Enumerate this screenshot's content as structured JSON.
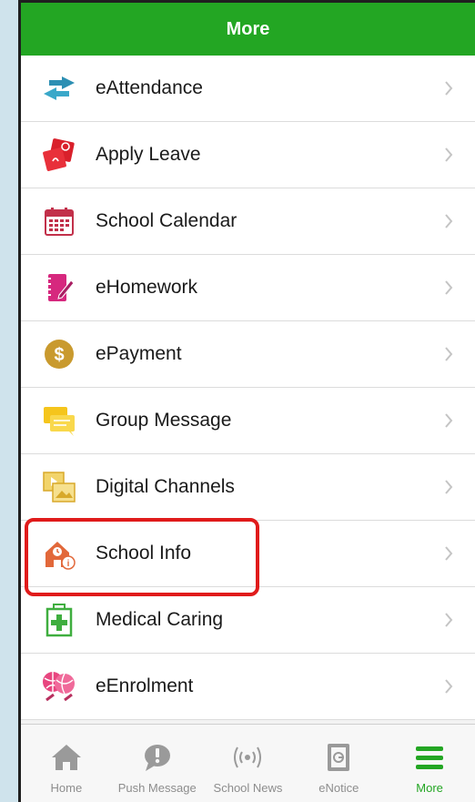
{
  "header": {
    "title": "More"
  },
  "menu": {
    "items": [
      {
        "label": "eAttendance",
        "icon": "swap-arrows-icon"
      },
      {
        "label": "Apply Leave",
        "icon": "leave-form-icon"
      },
      {
        "label": "School Calendar",
        "icon": "calendar-icon"
      },
      {
        "label": "eHomework",
        "icon": "homework-notebook-icon"
      },
      {
        "label": "ePayment",
        "icon": "dollar-coin-icon"
      },
      {
        "label": "Group Message",
        "icon": "chat-bubbles-icon"
      },
      {
        "label": "Digital Channels",
        "icon": "media-gallery-icon"
      },
      {
        "label": "School Info",
        "icon": "school-building-icon"
      },
      {
        "label": "Medical Caring",
        "icon": "medical-kit-icon"
      },
      {
        "label": "eEnrolment",
        "icon": "sports-balls-icon"
      }
    ]
  },
  "tabbar": {
    "tabs": [
      {
        "label": "Home",
        "icon": "home-icon"
      },
      {
        "label": "Push Message",
        "icon": "push-message-icon"
      },
      {
        "label": "School News",
        "icon": "broadcast-icon"
      },
      {
        "label": "eNotice",
        "icon": "notice-icon"
      },
      {
        "label": "More",
        "icon": "hamburger-menu-icon",
        "active": true
      }
    ]
  },
  "colors": {
    "navbar": "#23a623",
    "active_tab": "#23a623",
    "highlight": "#e01b1b",
    "chevron": "#c4c4c4"
  }
}
